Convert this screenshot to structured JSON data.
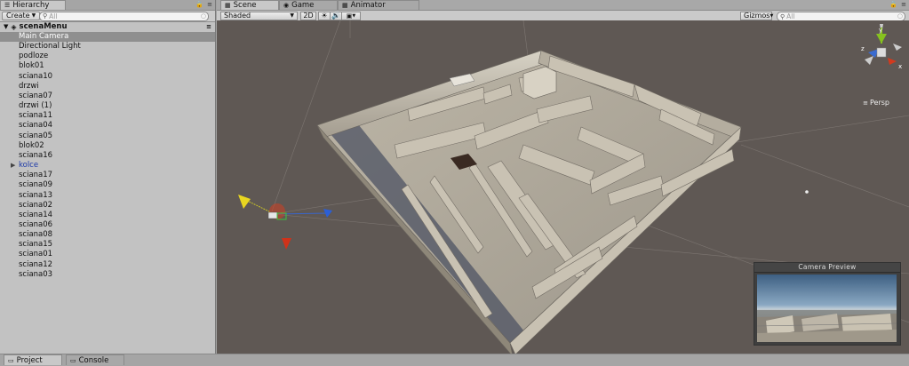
{
  "hierarchy": {
    "tab_label": "Hierarchy",
    "create_label": "Create",
    "search_placeholder": "All",
    "scene_name": "scenaMenu",
    "items": [
      {
        "label": "Main Camera",
        "selected": true
      },
      {
        "label": "Directional Light"
      },
      {
        "label": "podloze"
      },
      {
        "label": "blok01"
      },
      {
        "label": "sciana10"
      },
      {
        "label": "drzwi"
      },
      {
        "label": "sciana07"
      },
      {
        "label": "drzwi (1)"
      },
      {
        "label": "sciana11"
      },
      {
        "label": "sciana04"
      },
      {
        "label": "sciana05"
      },
      {
        "label": "blok02"
      },
      {
        "label": "sciana16"
      },
      {
        "label": "kolce",
        "prefab": true,
        "collapsed": true
      },
      {
        "label": "sciana17"
      },
      {
        "label": "sciana09"
      },
      {
        "label": "sciana13"
      },
      {
        "label": "sciana02"
      },
      {
        "label": "sciana14"
      },
      {
        "label": "sciana06"
      },
      {
        "label": "sciana08"
      },
      {
        "label": "sciana15"
      },
      {
        "label": "sciana01"
      },
      {
        "label": "sciana12"
      },
      {
        "label": "sciana03"
      }
    ]
  },
  "tabs": {
    "scene": "Scene",
    "game": "Game",
    "animator": "Animator"
  },
  "scene_toolbar": {
    "shading": "Shaded",
    "mode_2d": "2D",
    "gizmos": "Gizmos",
    "search_placeholder": "All"
  },
  "viewport": {
    "projection_label": "Persp",
    "camera_preview_title": "Camera Preview",
    "axis_labels": {
      "y": "y",
      "x": "x",
      "z": "z"
    }
  },
  "bottom_tabs": {
    "project": "Project",
    "console": "Console"
  },
  "colors": {
    "selected_row": "#8f8f8f",
    "prefab_text": "#1e3aa8",
    "viewport_bg": "#5f5854",
    "axis_x": "#d23a1e",
    "axis_y": "#86c21e",
    "axis_z": "#2a6fd6"
  }
}
